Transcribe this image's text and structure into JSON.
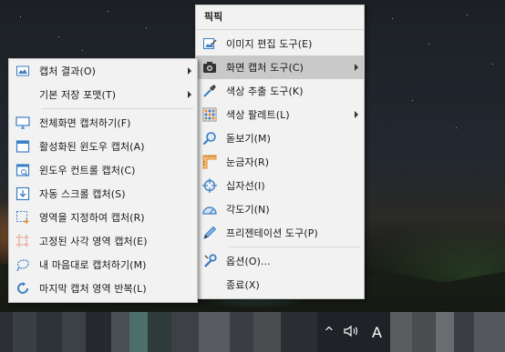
{
  "main_menu": {
    "title": "픽픽",
    "items": [
      {
        "label": "이미지 편집 도구(E)",
        "icon": "image-edit-icon"
      },
      {
        "label": "화면 캡처 도구(C)",
        "icon": "camera-icon",
        "submenu": true
      },
      {
        "label": "색상 추출 도구(K)",
        "icon": "eyedropper-icon"
      },
      {
        "label": "색상 팔레트(L)",
        "icon": "palette-grid-icon",
        "submenu": true
      },
      {
        "label": "돋보기(M)",
        "icon": "magnifier-icon"
      },
      {
        "label": "눈금자(R)",
        "icon": "ruler-icon"
      },
      {
        "label": "십자선(I)",
        "icon": "crosshair-icon"
      },
      {
        "label": "각도기(N)",
        "icon": "protractor-icon"
      },
      {
        "label": "프리젠테이션 도구(P)",
        "icon": "pen-icon"
      },
      {
        "label": "옵션(O)...",
        "icon": "wrench-icon"
      },
      {
        "label": "종료(X)",
        "icon": ""
      }
    ]
  },
  "capture_submenu": {
    "items": [
      {
        "label": "캡처 결과(O)",
        "icon": "capture-result-icon",
        "submenu": true
      },
      {
        "label": "기본 저장 포맷(T)",
        "icon": "",
        "submenu": true
      },
      {
        "label": "전체화면 캡처하기(F)",
        "icon": "monitor-icon"
      },
      {
        "label": "활성화된 윈도우 캡처(A)",
        "icon": "window-icon"
      },
      {
        "label": "윈도우 컨트롤 캡처(C)",
        "icon": "window-control-icon"
      },
      {
        "label": "자동 스크롤 캡처(S)",
        "icon": "scroll-capture-icon"
      },
      {
        "label": "영역을 지정하여 캡처(R)",
        "icon": "region-select-icon"
      },
      {
        "label": "고정된 사각 영역 캡처(E)",
        "icon": "fixed-region-icon"
      },
      {
        "label": "내 마음대로 캡처하기(M)",
        "icon": "freehand-lasso-icon"
      },
      {
        "label": "마지막 캡처 영역 반복(L)",
        "icon": "repeat-icon"
      }
    ]
  },
  "taskbar": {
    "tray": {
      "chevron": "^",
      "volume_icon": "speaker-icon",
      "ime_indicator": "A"
    }
  },
  "colors": {
    "menu_bg": "#f2f2f2",
    "menu_active": "#c9c9c9",
    "accent_blue": "#3b7fc4",
    "accent_orange": "#e08a2a",
    "taskbar_bg": "#1f2328"
  }
}
